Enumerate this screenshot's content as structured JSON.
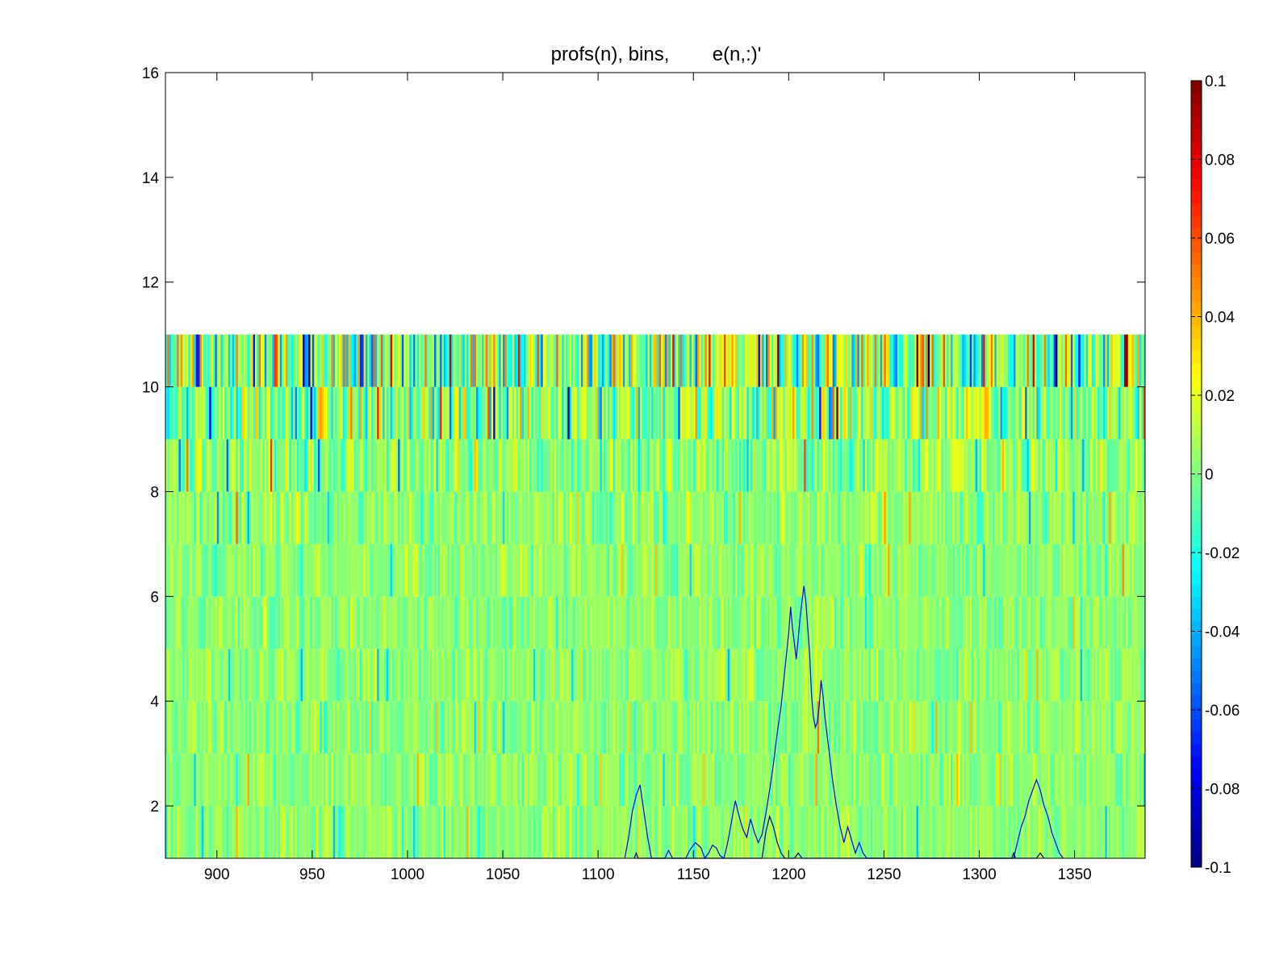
{
  "chart_data": {
    "type": "heatmap",
    "title": "profs(n), bins,        e(n,:)'",
    "xlim": [
      873,
      1387
    ],
    "ylim": [
      1,
      16
    ],
    "x_ticks": [
      900,
      950,
      1000,
      1050,
      1100,
      1150,
      1200,
      1250,
      1300,
      1350
    ],
    "y_ticks": [
      2,
      4,
      6,
      8,
      10,
      12,
      14,
      16
    ],
    "heatmap": {
      "rows_filled": 10,
      "row_height": 1,
      "bin_width": 1,
      "colormap": "jet",
      "clim": [
        -0.1,
        0.1
      ],
      "row_spread": [
        0.012,
        0.012,
        0.012,
        0.012,
        0.012,
        0.012,
        0.014,
        0.02,
        0.035,
        0.05
      ]
    },
    "line_series": [
      {
        "color": "#0000ff",
        "points": [
          [
            1114,
            1
          ],
          [
            1116,
            1.4
          ],
          [
            1118,
            1.9
          ],
          [
            1120,
            2.2
          ],
          [
            1122,
            2.4
          ],
          [
            1124,
            1.9
          ],
          [
            1126,
            1.4
          ],
          [
            1128,
            1
          ],
          [
            1135,
            1
          ],
          [
            1137,
            1.15
          ],
          [
            1139,
            1
          ],
          [
            1146,
            1
          ],
          [
            1148,
            1.15
          ],
          [
            1151,
            1.3
          ],
          [
            1154,
            1.2
          ],
          [
            1156,
            1
          ],
          [
            1158,
            1.1
          ],
          [
            1160,
            1.25
          ],
          [
            1162,
            1.2
          ],
          [
            1164,
            1.05
          ],
          [
            1166,
            1
          ],
          [
            1168,
            1.3
          ],
          [
            1170,
            1.7
          ],
          [
            1172,
            2.1
          ],
          [
            1174,
            1.8
          ],
          [
            1176,
            1.55
          ],
          [
            1178,
            1.4
          ],
          [
            1180,
            1.75
          ],
          [
            1182,
            1.5
          ],
          [
            1184,
            1.3
          ],
          [
            1186,
            1.45
          ],
          [
            1188,
            1.85
          ],
          [
            1190,
            2.3
          ],
          [
            1192,
            2.8
          ],
          [
            1194,
            3.4
          ],
          [
            1196,
            3.9
          ],
          [
            1198,
            4.6
          ],
          [
            1200,
            5.3
          ],
          [
            1201,
            5.8
          ],
          [
            1202,
            5.4
          ],
          [
            1203,
            5.1
          ],
          [
            1204,
            4.8
          ],
          [
            1205,
            5.2
          ],
          [
            1206,
            5.6
          ],
          [
            1207,
            5.9
          ],
          [
            1208,
            6.2
          ],
          [
            1209,
            5.9
          ],
          [
            1210,
            5.4
          ],
          [
            1211,
            4.9
          ],
          [
            1212,
            4.1
          ],
          [
            1213,
            3.7
          ],
          [
            1214,
            3.5
          ],
          [
            1215,
            3.6
          ],
          [
            1216,
            3.9
          ],
          [
            1217,
            4.4
          ],
          [
            1218,
            4.1
          ],
          [
            1219,
            3.7
          ],
          [
            1221,
            3.1
          ],
          [
            1223,
            2.5
          ],
          [
            1225,
            2.0
          ],
          [
            1227,
            1.6
          ],
          [
            1229,
            1.3
          ],
          [
            1231,
            1.6
          ],
          [
            1233,
            1.35
          ],
          [
            1235,
            1.1
          ],
          [
            1237,
            1.3
          ],
          [
            1239,
            1.1
          ],
          [
            1241,
            1
          ],
          [
            1318,
            1
          ],
          [
            1320,
            1.3
          ],
          [
            1322,
            1.6
          ],
          [
            1324,
            1.8
          ],
          [
            1326,
            2.1
          ],
          [
            1328,
            2.3
          ],
          [
            1330,
            2.5
          ],
          [
            1332,
            2.3
          ],
          [
            1334,
            2.0
          ],
          [
            1336,
            1.8
          ],
          [
            1338,
            1.5
          ],
          [
            1340,
            1.3
          ],
          [
            1342,
            1.1
          ],
          [
            1344,
            1
          ]
        ]
      },
      {
        "color": "#000080",
        "points": [
          [
            1119,
            1
          ],
          [
            1120,
            1.1
          ],
          [
            1121,
            1
          ],
          [
            1186,
            1
          ],
          [
            1188,
            1.5
          ],
          [
            1190,
            1.8
          ],
          [
            1192,
            1.6
          ],
          [
            1194,
            1.3
          ],
          [
            1196,
            1.1
          ],
          [
            1198,
            1
          ],
          [
            1203,
            1
          ],
          [
            1205,
            1.1
          ],
          [
            1207,
            1
          ],
          [
            1317,
            1
          ],
          [
            1318,
            1.1
          ],
          [
            1319,
            1
          ],
          [
            1330,
            1
          ],
          [
            1332,
            1.1
          ],
          [
            1334,
            1
          ]
        ]
      }
    ]
  },
  "colorbar": {
    "ticks": [
      "0.1",
      "0.08",
      "0.06",
      "0.04",
      "0.02",
      "0",
      "-0.02",
      "-0.04",
      "-0.06",
      "-0.08",
      "-0.1"
    ]
  }
}
